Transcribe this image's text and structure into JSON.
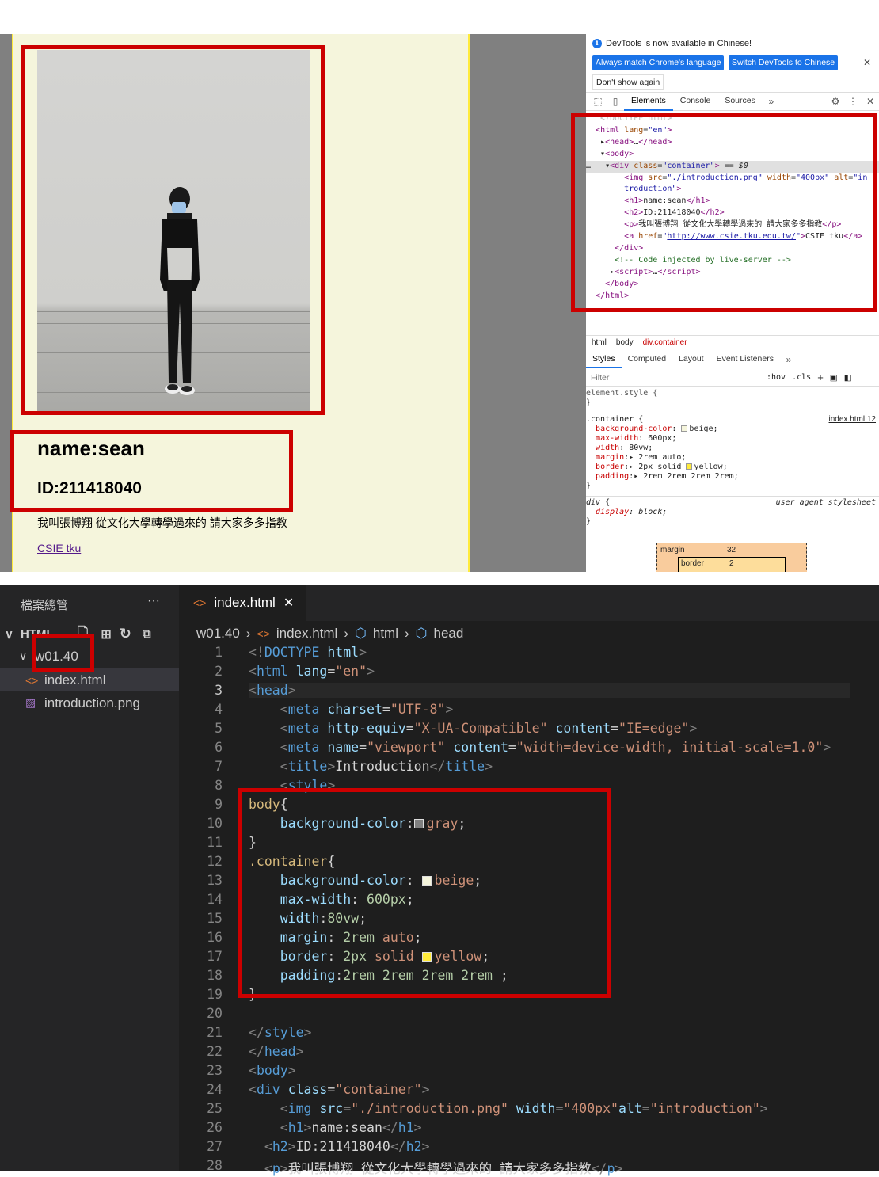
{
  "preview": {
    "name": "name:sean",
    "id": "ID:211418040",
    "intro": "我叫張博翔 從文化大學轉學過來的 請大家多多指教",
    "link": "CSIE tku"
  },
  "devtools": {
    "notice": "DevTools is now available in Chinese!",
    "btn_match": "Always match Chrome's language",
    "btn_switch": "Switch DevTools to Chinese",
    "btn_dont": "Don't show again",
    "tabs": [
      "Elements",
      "Console",
      "Sources"
    ],
    "crumbs": [
      "html",
      "body",
      "div.container"
    ],
    "style_tabs": [
      "Styles",
      "Computed",
      "Layout",
      "Event Listeners"
    ],
    "filter_placeholder": "Filter",
    "filter_hov": ":hov",
    "filter_cls": ".cls",
    "source_link": "index.html:12",
    "ua_label": "user agent stylesheet",
    "box_margin_label": "margin",
    "box_margin_value": "32",
    "box_border_label": "border",
    "box_border_value": "2"
  },
  "vscode": {
    "explorer_title": "檔案總管",
    "root_folder": "HTML",
    "folder": "w01.40",
    "files": [
      "index.html",
      "introduction.png"
    ],
    "tab": "index.html",
    "breadcrumb": [
      "w01.40",
      "index.html",
      "html",
      "head"
    ]
  },
  "colors": {
    "highlight": "#cc0000",
    "accent": "#1a73e8",
    "beige": "#f5f5dc",
    "yellow": "#ffeb3b",
    "gray": "#808080"
  }
}
